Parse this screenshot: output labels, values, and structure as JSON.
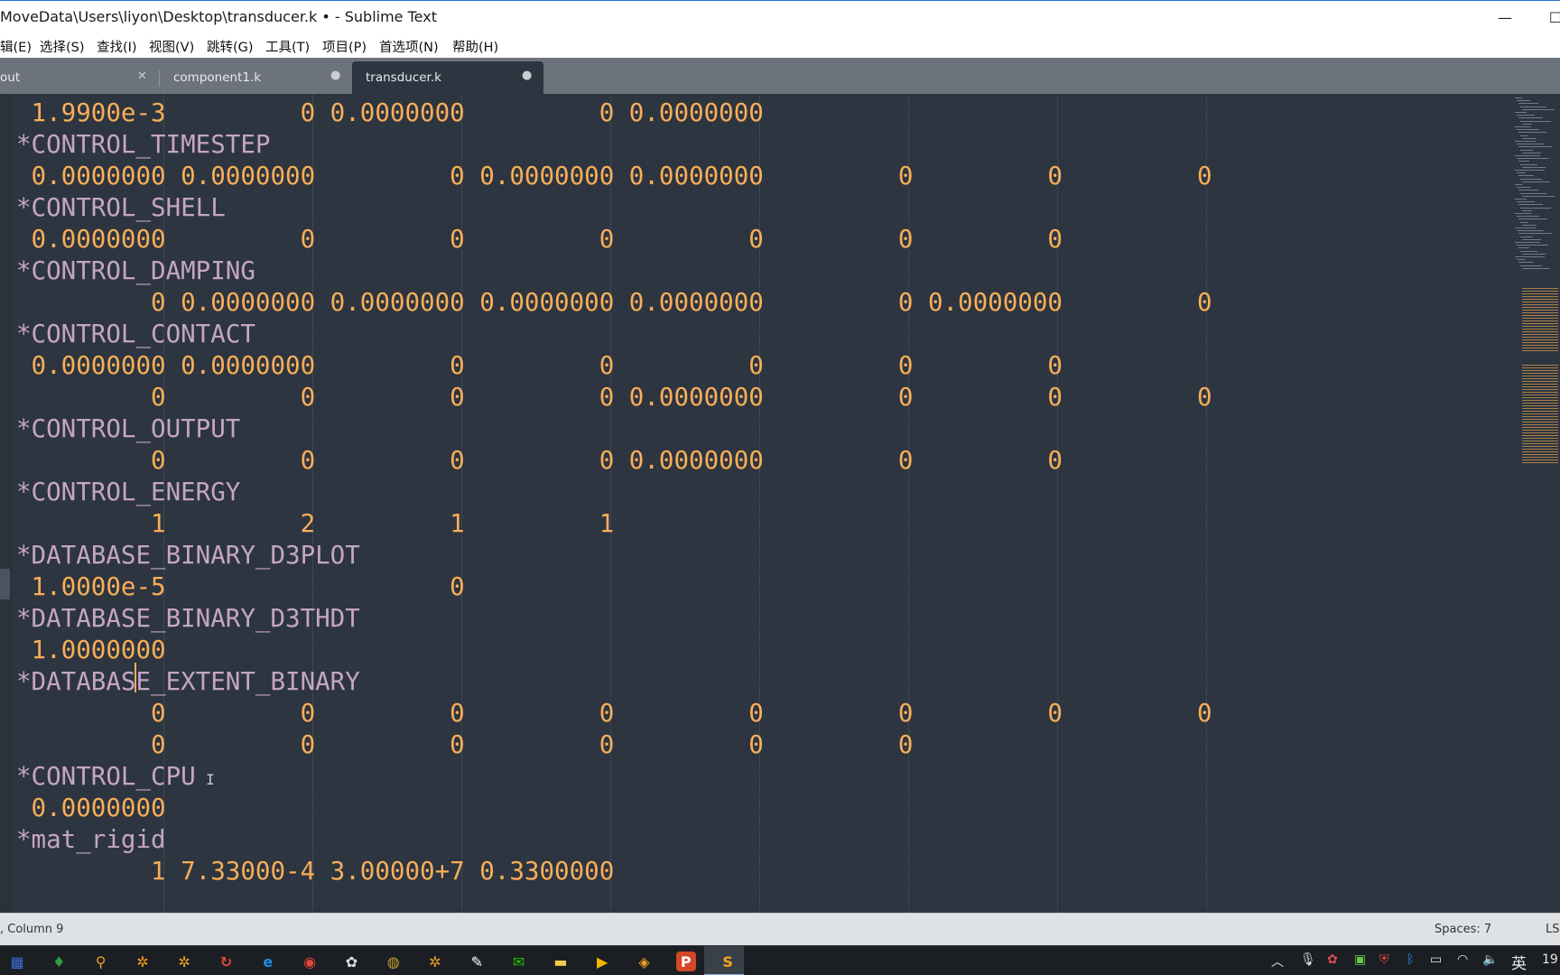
{
  "window": {
    "title": "MoveData\\Users\\liyon\\Desktop\\transducer.k • - Sublime Text",
    "minimize_glyph": "—",
    "maximize_glyph": "☐"
  },
  "menu": [
    "辑(E)",
    "选择(S)",
    "查找(I)",
    "视图(V)",
    "跳转(G)",
    "工具(T)",
    "项目(P)",
    "首选项(N)",
    "帮助(H)"
  ],
  "tabs": [
    {
      "label": "out",
      "control": "✕",
      "active": false
    },
    {
      "label": "component1.k",
      "control": "●",
      "active": false
    },
    {
      "label": "transducer.k",
      "control": "●",
      "active": true
    }
  ],
  "code_lines": [
    [
      {
        "t": " 1.9900e-3         0 0.0000000         0 0.0000000",
        "c": "num"
      }
    ],
    [
      {
        "t": "*CONTROL_TIMESTEP",
        "c": "kw"
      }
    ],
    [
      {
        "t": " 0.0000000 0.0000000         0 0.0000000 0.0000000         0         0         0",
        "c": "num"
      }
    ],
    [
      {
        "t": "*CONTROL_SHELL",
        "c": "kw"
      }
    ],
    [
      {
        "t": " 0.0000000         0         0         0         0         0         0",
        "c": "num"
      }
    ],
    [
      {
        "t": "*CONTROL_DAMPING",
        "c": "kw"
      }
    ],
    [
      {
        "t": "         0 0.0000000 0.0000000 0.0000000 0.0000000         0 0.0000000         0",
        "c": "num"
      }
    ],
    [
      {
        "t": "*CONTROL_CONTACT",
        "c": "kw"
      }
    ],
    [
      {
        "t": " 0.0000000 0.0000000         0         0         0         0         0",
        "c": "num"
      }
    ],
    [
      {
        "t": "         0         0         0         0 0.0000000         0         0         0",
        "c": "num"
      }
    ],
    [
      {
        "t": "*CONTROL_OUTPUT",
        "c": "kw"
      }
    ],
    [
      {
        "t": "         0         0         0         0 0.0000000         0         0",
        "c": "num"
      }
    ],
    [
      {
        "t": "*CONTROL_ENERGY",
        "c": "kw"
      }
    ],
    [
      {
        "t": "         1         2         1         1",
        "c": "num"
      }
    ],
    [
      {
        "t": "*DATABASE_BINARY_D3PLOT",
        "c": "kw"
      }
    ],
    [
      {
        "t": " 1.0000e-5                   0",
        "c": "num"
      }
    ],
    [
      {
        "t": "*DATABASE_BINARY_D3THDT",
        "c": "kw"
      }
    ],
    [
      {
        "t": " 1.0000000",
        "c": "num"
      }
    ],
    [
      {
        "t": "*DATABASE_EXTENT_BINARY",
        "c": "kw"
      }
    ],
    [
      {
        "t": "         0         0         0         0         0         0         0         0",
        "c": "num"
      }
    ],
    [
      {
        "t": "         0         0         0         0         0         0",
        "c": "num"
      }
    ],
    [
      {
        "t": "*CONTROL_CPU",
        "c": "kw"
      }
    ],
    [
      {
        "t": " 0.0000000",
        "c": "num"
      }
    ],
    [
      {
        "t": "*mat_rigid",
        "c": "kw"
      }
    ],
    [
      {
        "t": "         1 7.33000-4 3.00000+7 0.3300000",
        "c": "num"
      }
    ]
  ],
  "status": {
    "position": ", Column 9",
    "spaces": "Spaces: 7",
    "syntax": "LS"
  },
  "taskbar": {
    "icons": [
      "calculator-icon",
      "app-icon",
      "search-icon",
      "gear-icon",
      "gear-icon",
      "swirl-icon",
      "edge-icon",
      "chrome-icon",
      "gear-icon",
      "app-icon",
      "gear-icon",
      "app-icon",
      "wechat-icon",
      "folder-icon",
      "video-icon",
      "app-icon",
      "powerpoint-icon",
      "sublime-icon"
    ],
    "ime": "英",
    "clock": "19"
  },
  "colors": {
    "editor_bg": "#2d3540",
    "keyword": "#c5a5c5",
    "number": "#f9ae58",
    "tabbar": "#6c737c"
  }
}
